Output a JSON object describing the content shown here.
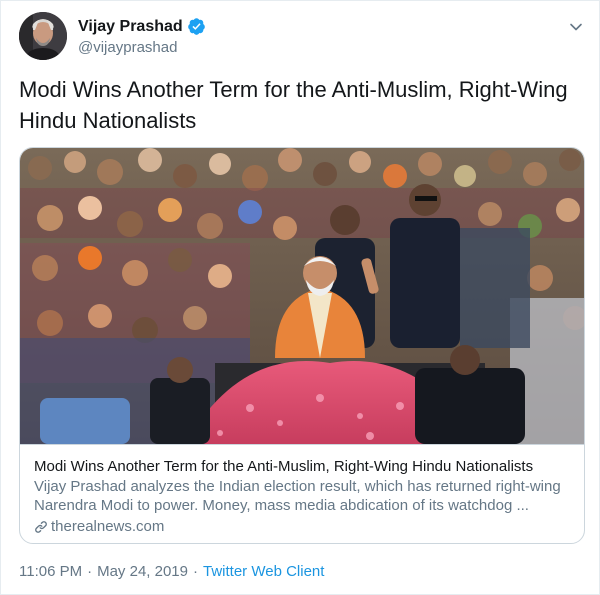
{
  "user": {
    "display_name": "Vijay Prashad",
    "handle": "@vijayprashad",
    "verified_icon": "verified-badge-icon"
  },
  "tweet": {
    "text": "Modi Wins Another Term for the Anti-Muslim, Right-Wing Hindu Nationalists"
  },
  "card": {
    "title": "Modi Wins Another Term for the Anti-Muslim, Right-Wing Hindu Nationalists",
    "description": "Vijay Prashad analyzes the Indian election result, which has returned right-wing Narendra Modi to power. Money, mass media abdication of its watchdog ...",
    "domain": "therealnews.com",
    "link_icon": "link-icon"
  },
  "footer": {
    "time": "11:06 PM",
    "date": "May 24, 2019",
    "separator": "·",
    "source": "Twitter Web Client"
  },
  "colors": {
    "text": "#14171a",
    "secondary": "#657786",
    "link": "#1b95e0",
    "border": "#ccd6dd"
  }
}
